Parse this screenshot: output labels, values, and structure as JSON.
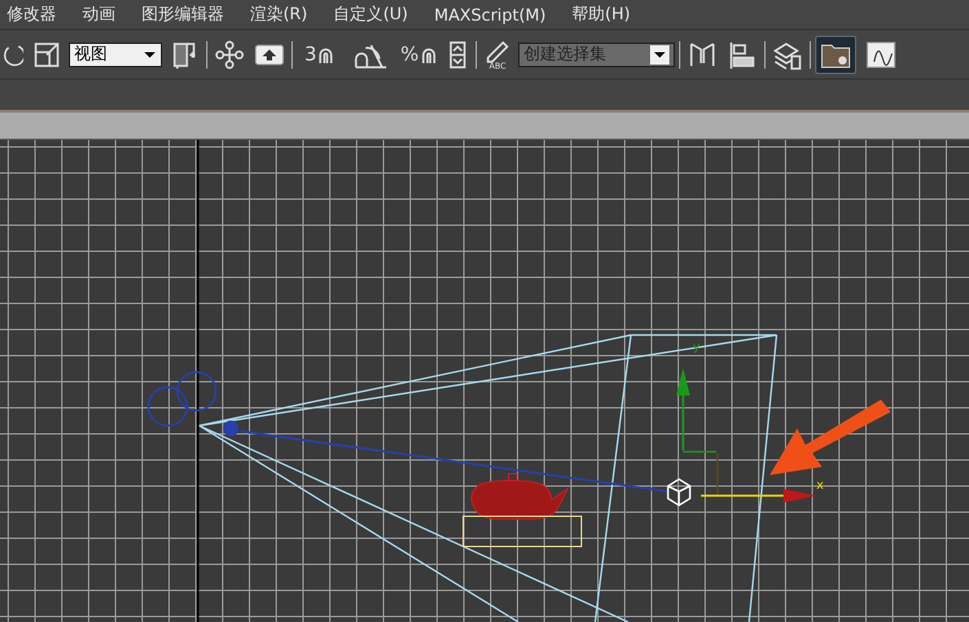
{
  "menu_bar": {
    "items": [
      {
        "label": "修改器"
      },
      {
        "label": "动画"
      },
      {
        "label": "图形编辑器"
      },
      {
        "label": "渲染(R)"
      },
      {
        "label": "自定义(U)"
      },
      {
        "label": "MAXScript(M)"
      },
      {
        "label": "帮助(H)"
      }
    ]
  },
  "toolbar": {
    "view_dropdown": {
      "value": "视图"
    },
    "snap_labels": [
      "3",
      "%"
    ],
    "edit_named_label": "ABC",
    "selection_set_dropdown": {
      "value": "创建选择集"
    },
    "scene_button": {
      "selected": true
    },
    "graph_button": {
      "selected": false
    }
  },
  "viewport": {
    "axis_labels": [
      "y",
      "x"
    ]
  }
}
